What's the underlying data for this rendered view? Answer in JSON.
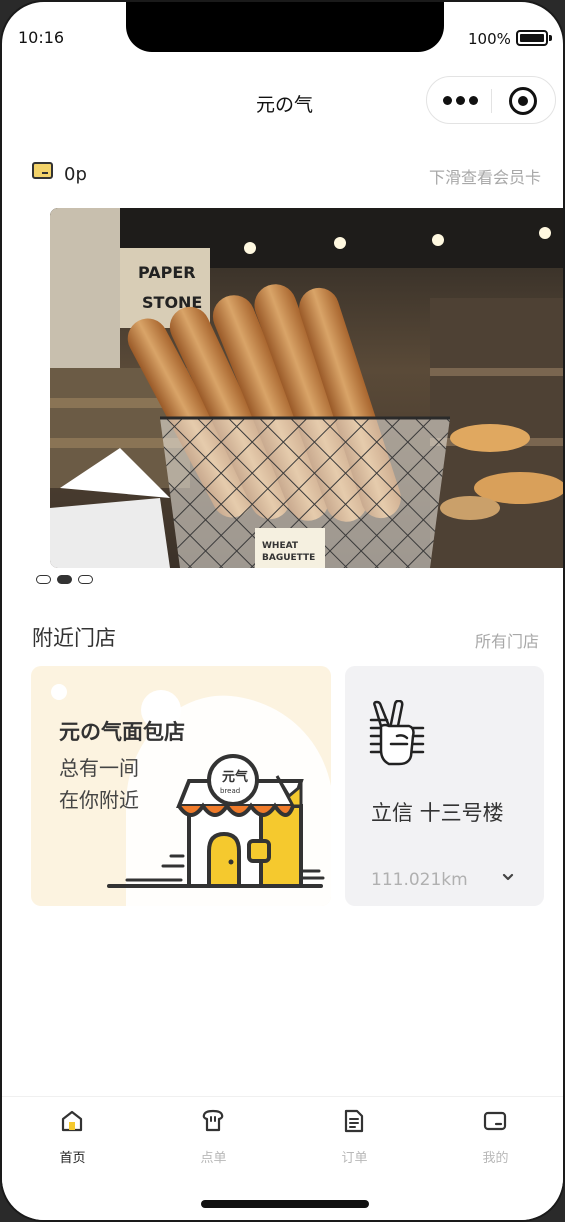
{
  "status_bar": {
    "time": "10:16",
    "battery": "100%"
  },
  "nav": {
    "title": "元の气"
  },
  "member": {
    "points": "0p",
    "hint": "下滑查看会员卡"
  },
  "banner": {
    "sign_text_1": "PAPER",
    "sign_text_2": "STONE",
    "tag_text_1": "WHEAT",
    "tag_text_2": "BAGUETTE",
    "page_count": 3,
    "active_index": 1
  },
  "nearby": {
    "title": "附近门店",
    "all_link": "所有门店",
    "promo": {
      "title": "元の气面包店",
      "line1": "总有一间",
      "line2": "在你附近",
      "shop_sign": "元气",
      "shop_sign_sub": "bread"
    },
    "store": {
      "name": "立信 十三号楼",
      "distance": "111.021km"
    }
  },
  "tabs": [
    {
      "label": "首页",
      "icon": "home-icon",
      "active": true
    },
    {
      "label": "点单",
      "icon": "bread-icon",
      "active": false
    },
    {
      "label": "订单",
      "icon": "document-icon",
      "active": false
    },
    {
      "label": "我的",
      "icon": "wallet-icon",
      "active": false
    }
  ],
  "colors": {
    "accent": "#f5c92e",
    "promo_bg": "#fcf3e0",
    "awning_orange": "#f07b2a",
    "store_card_bg": "#f2f2f4"
  }
}
